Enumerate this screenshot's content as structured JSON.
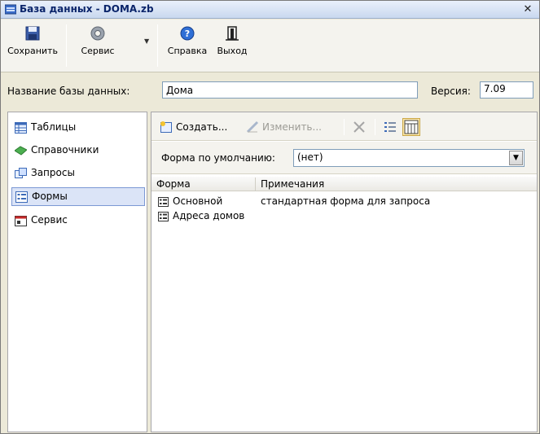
{
  "window": {
    "title": "База данных - DOMA.zb",
    "close_glyph": "✕"
  },
  "toolbar": {
    "save": {
      "label": "Сохранить",
      "icon": "save-icon"
    },
    "service": {
      "label": "Сервис",
      "icon": "gear-icon",
      "has_dropdown": true
    },
    "help": {
      "label": "Справка",
      "icon": "help-icon"
    },
    "exit": {
      "label": "Выход",
      "icon": "exit-icon"
    }
  },
  "database": {
    "name_label": "Название базы данных:",
    "name_value": "Дома",
    "version_label": "Версия:",
    "version_value": "7.09"
  },
  "sidebar": {
    "items": [
      {
        "label": "Таблицы",
        "icon": "table-icon",
        "selected": false
      },
      {
        "label": "Справочники",
        "icon": "book-icon",
        "selected": false
      },
      {
        "label": "Запросы",
        "icon": "query-icon",
        "selected": false
      },
      {
        "label": "Формы",
        "icon": "form-icon",
        "selected": true
      },
      {
        "label": "Сервис",
        "icon": "service-icon",
        "selected": false
      }
    ]
  },
  "forms_pane": {
    "create_label": "Создать...",
    "edit_label": "Изменить...",
    "default_form_label": "Форма по умолчанию:",
    "default_form_value": "(нет)",
    "columns": [
      "Форма",
      "Примечания"
    ],
    "rows": [
      {
        "name": "Основной",
        "note": "стандартная форма для запроса"
      },
      {
        "name": "Адреса домов",
        "note": ""
      }
    ]
  }
}
